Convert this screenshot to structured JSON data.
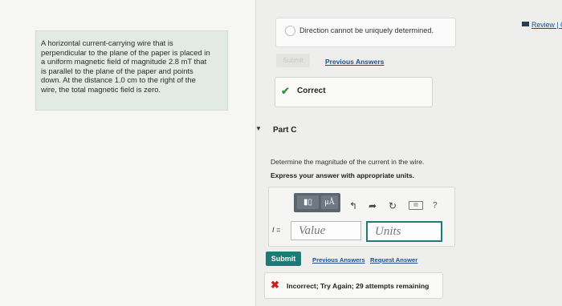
{
  "problem": {
    "lines": [
      "A horizontal current-carrying wire that is",
      "perpendicular to the plane of the paper is placed in",
      "a uniform magnetic field of magnitude 2.8 mT that",
      "is parallel to the plane of the paper and points",
      "down. At the distance 1.0 cm to the right of the",
      "wire, the total magnetic field is zero."
    ]
  },
  "part_b": {
    "option_label": "Direction cannot be uniquely determined.",
    "submit_label": "Submit",
    "previous_answers_label": "Previous Answers",
    "feedback": "Correct"
  },
  "part_c": {
    "caret": "▼",
    "label": "Part C",
    "question": "Determine the magnitude of the current in the wire.",
    "instruction": "Express your answer with appropriate units.",
    "toolbar": {
      "templates_label": "▮▯",
      "units_label": "μÅ"
    },
    "variable": "I =",
    "value_placeholder": "Value",
    "units_placeholder": "Units",
    "submit_label": "Submit",
    "previous_answers_label": "Previous Answers",
    "request_answer_label": "Request Answer",
    "feedback": "Incorrect; Try Again; 29 attempts remaining"
  },
  "header": {
    "review_label": "Review | C"
  },
  "colors": {
    "accent_teal": "#1d7a75",
    "correct_green": "#3e8f3a",
    "incorrect_red": "#c8211f",
    "link_blue": "#1d4f8f"
  }
}
